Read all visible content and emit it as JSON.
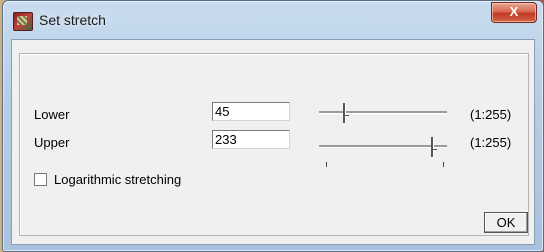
{
  "window": {
    "title": "Set stretch",
    "close_label": "X"
  },
  "lower": {
    "label": "Lower",
    "value": "45",
    "range": "(1:255)",
    "slider_value": 45
  },
  "upper": {
    "label": "Upper",
    "value": "233",
    "range": "(1:255)",
    "slider_value": 233
  },
  "slider_scale": {
    "min": 1,
    "max": 255
  },
  "log_stretch": {
    "label": "Logarithmic stretching",
    "checked": false
  },
  "ok_label": "OK"
}
